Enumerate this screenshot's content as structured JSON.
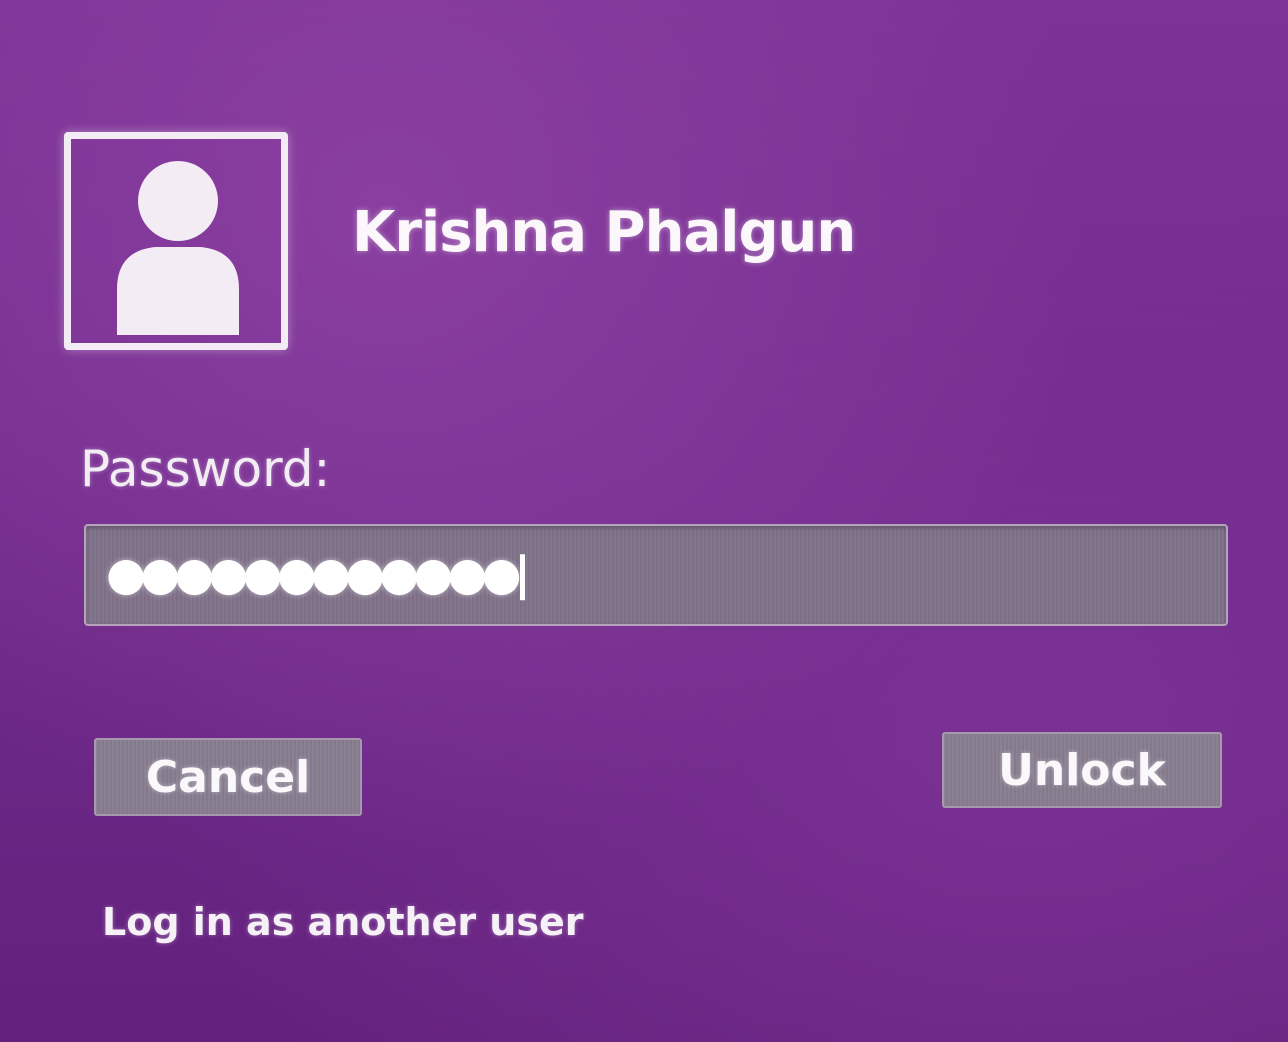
{
  "user": {
    "name": "Krishna Phalgun",
    "avatar_icon": "user-silhouette-icon"
  },
  "password": {
    "label": "Password:",
    "masked_value": "●●●●●●●●●●●●"
  },
  "buttons": {
    "cancel_label": "Cancel",
    "unlock_label": "Unlock"
  },
  "links": {
    "switch_user_label": "Log in as another user"
  },
  "colors": {
    "background": "#6f2d88",
    "text": "#f4eef6",
    "field_background": "#84768c",
    "button_background": "#8b8193"
  }
}
